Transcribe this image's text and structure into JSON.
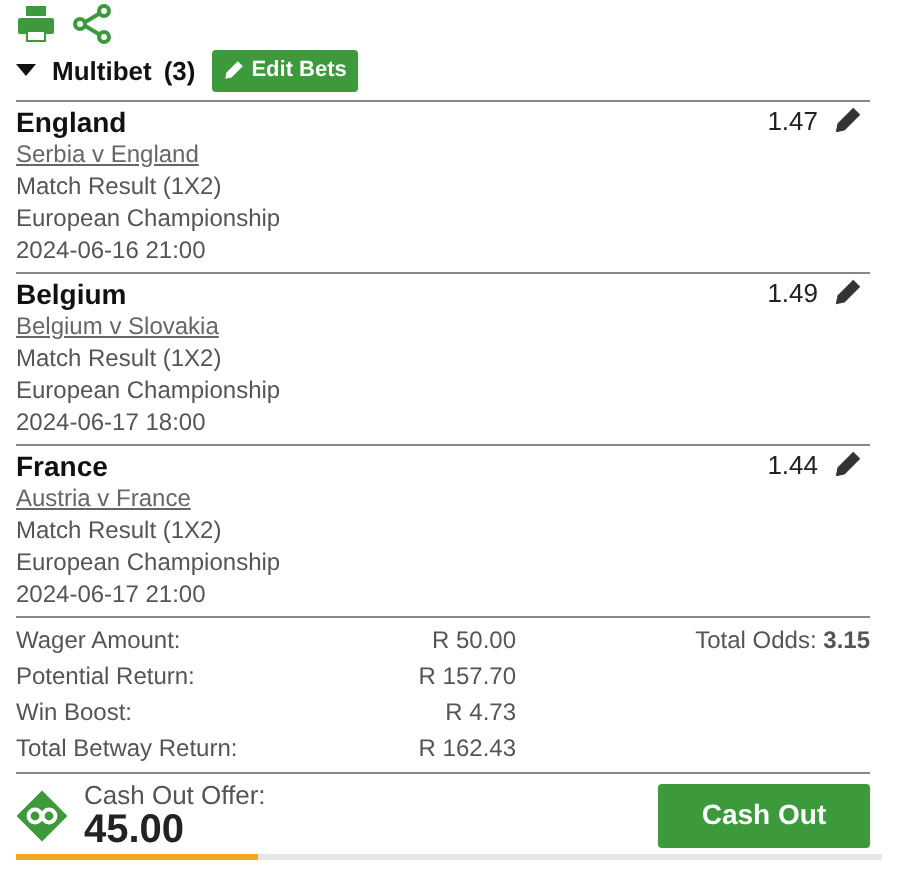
{
  "header": {
    "title": "Multibet",
    "count": "(3)",
    "expanded": true,
    "edit_button": "Edit Bets"
  },
  "selections": [
    {
      "team": "England",
      "match": "Serbia v England",
      "market": "Match Result (1X2)",
      "competition": "European Championship",
      "date": "2024-06-16 21:00",
      "odds": "1.47"
    },
    {
      "team": "Belgium",
      "match": "Belgium v Slovakia",
      "market": "Match Result (1X2)",
      "competition": "European Championship",
      "date": "2024-06-17 18:00",
      "odds": "1.49"
    },
    {
      "team": "France",
      "match": "Austria v France",
      "market": "Match Result (1X2)",
      "competition": "European Championship",
      "date": "2024-06-17 21:00",
      "odds": "1.44"
    }
  ],
  "summary": [
    {
      "label": "Wager Amount:",
      "value": "R 50.00"
    },
    {
      "label": "Potential Return:",
      "value": "R 157.70"
    },
    {
      "label": "Win Boost:",
      "value": "R 4.73"
    },
    {
      "label": "Total Betway Return:",
      "value": "R 162.43"
    }
  ],
  "total_odds": "Total Odds: **3.15**",
  "cash_out": {
    "label": "Cash Out Offer:",
    "amount": "45.00",
    "button": "Cash Out",
    "level": 0.28
  }
}
